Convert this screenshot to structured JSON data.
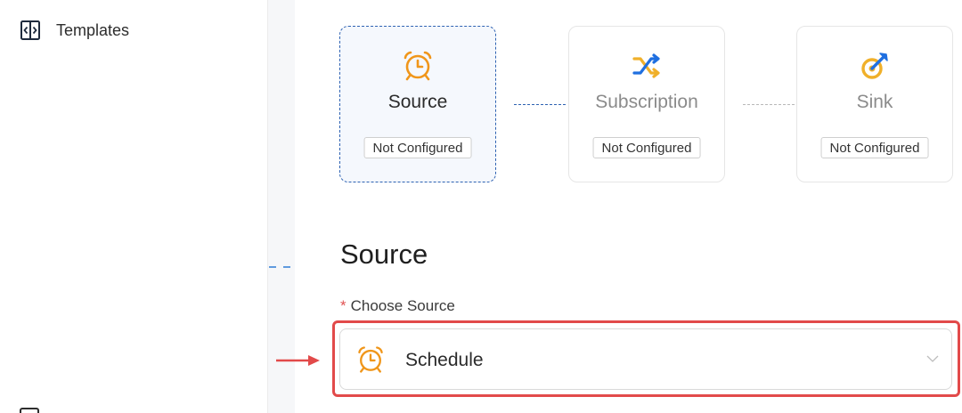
{
  "sidebar": {
    "templates_label": "Templates",
    "templates_icon": "code-brackets-icon"
  },
  "steps": [
    {
      "title": "Source",
      "status": "Not Configured",
      "icon": "alarm-clock-icon",
      "active": true
    },
    {
      "title": "Subscription",
      "status": "Not Configured",
      "icon": "shuffle-icon",
      "active": false
    },
    {
      "title": "Sink",
      "status": "Not Configured",
      "icon": "target-arrow-icon",
      "active": false
    }
  ],
  "section": {
    "title": "Source",
    "field_label": "Choose Source",
    "required_mark": "*",
    "selected_value": "Schedule",
    "selected_icon": "alarm-clock-icon"
  },
  "colors": {
    "accent": "#2e62b2",
    "orange": "#f0961a",
    "highlight": "#e24a4a",
    "active_bg": "#f5f8fd"
  }
}
